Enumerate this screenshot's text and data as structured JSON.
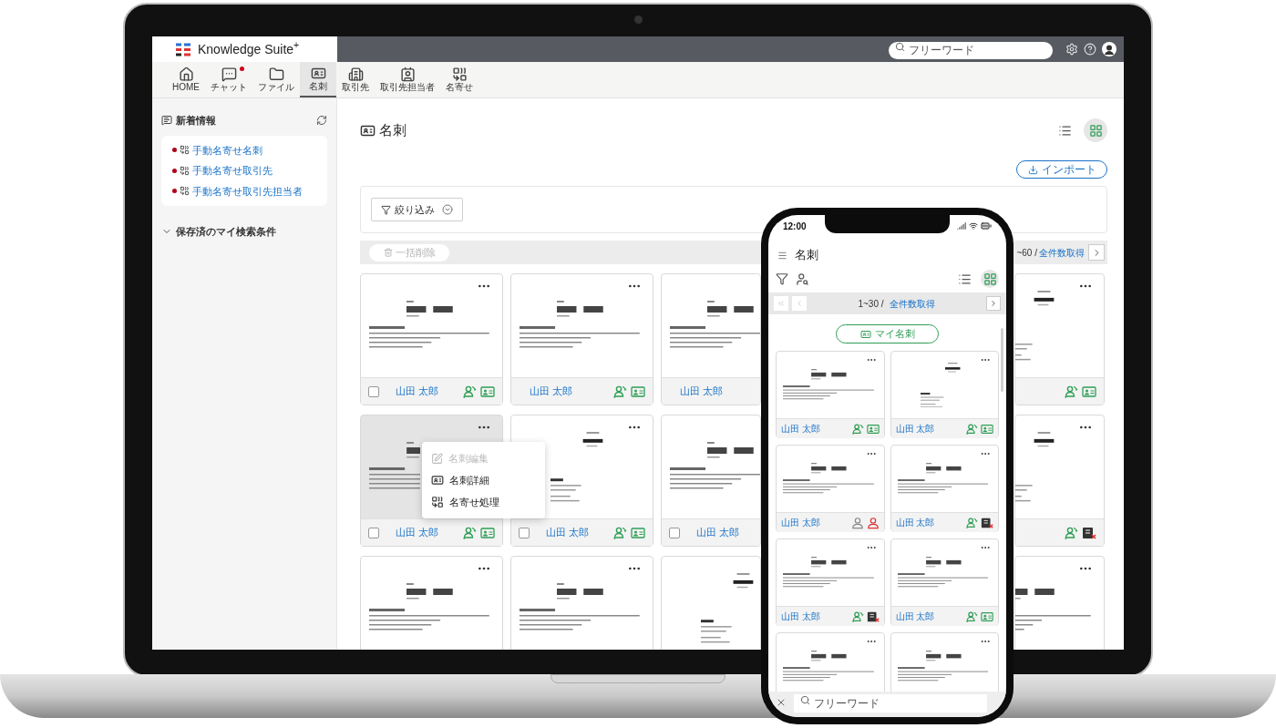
{
  "laptop": {
    "header": {
      "logo": "Knowledge Suite$^{+}$",
      "search": {
        "placeholder": "フリーワード"
      }
    },
    "nav": [
      {
        "label": "HOME",
        "selected": false,
        "badge": false
      },
      {
        "label": "チャット",
        "selected": false,
        "badge": true
      },
      {
        "label": "ファイル",
        "selected": false,
        "badge": false
      },
      {
        "label": "名刺",
        "selected": true,
        "badge": false
      },
      {
        "label": "取引先",
        "selected": false,
        "badge": false
      },
      {
        "label": "取引先担当者",
        "selected": false,
        "badge": false
      },
      {
        "label": "名寄せ",
        "selected": false,
        "badge": false
      }
    ],
    "sidebar": {
      "news_title": "新着情報",
      "news_items": [
        "手動名寄せ名刺",
        "手動名寄せ取引先",
        "手動名寄せ取引先担当者"
      ],
      "saved_searches": "保存済のマイ検索条件"
    },
    "main": {
      "title": "名刺",
      "views": [
        {
          "kind": "list",
          "selected": false
        },
        {
          "kind": "grid",
          "selected": true
        }
      ],
      "import_button": "インポート",
      "filter_button": "絞り込み",
      "bulk_delete": {
        "label": "一括削除",
        "disabled": true
      },
      "paging": {
        "range": "~60 /",
        "link": "全件数取得"
      },
      "card_rows": [
        {
          "cards": [
            {
              "highlighted": false,
              "checked": false,
              "name": "山田 太郎",
              "menu_button": true,
              "icons": [
                {
                  "kind": "sync"
                },
                {
                  "kind": "card"
                }
              ]
            },
            {
              "highlighted": false,
              "name": "山田 太郎",
              "menu_button": true,
              "icons": [
                {
                  "kind": "sync"
                },
                {
                  "kind": "card"
                }
              ]
            },
            {
              "highlighted": false,
              "name": "山田 太郎"
            },
            {
              "highlighted": false,
              "menu_button": true,
              "icons": [
                {
                  "kind": "sync"
                },
                {
                  "kind": "card"
                }
              ]
            }
          ]
        },
        {
          "cards": [
            {
              "highlighted": true,
              "checked": false,
              "name": "山田 太郎",
              "menu_button": true,
              "icons": [
                {
                  "kind": "sync"
                },
                {
                  "kind": "card"
                }
              ],
              "menu": [
                {
                  "label": "名刺編集",
                  "kind": "edit",
                  "disabled": true
                },
                {
                  "label": "名刺詳細",
                  "kind": "detail",
                  "disabled": false
                },
                {
                  "label": "名寄せ処理",
                  "kind": "merge",
                  "disabled": false
                }
              ]
            },
            {
              "highlighted": false,
              "checked": false,
              "name": "山田 太郎",
              "menu_button": true,
              "icons": [
                {
                  "kind": "sync"
                },
                {
                  "kind": "card"
                }
              ]
            },
            {
              "highlighted": false,
              "checked": false,
              "name": "山田 太郎"
            },
            {
              "highlighted": false,
              "menu_button": true,
              "icons": [
                {
                  "kind": "sync"
                },
                {
                  "kind": "card_x"
                }
              ]
            }
          ]
        },
        {
          "cards": [
            {
              "highlighted": false,
              "menu_button": true
            },
            {
              "highlighted": false,
              "menu_button": true
            },
            {
              "highlighted": false
            },
            {
              "highlighted": false,
              "menu_button": true
            }
          ]
        }
      ]
    }
  },
  "phone": {
    "time": "12:00",
    "title": "名刺",
    "views": [
      {
        "kind": "list",
        "selected": false
      },
      {
        "kind": "grid",
        "selected": true
      }
    ],
    "paging": {
      "range": "1~30 /",
      "link": "全件数取得",
      "back_disabled": true
    },
    "my_cards_button": "マイ名刺",
    "cards": [
      {
        "menu_button": true,
        "name": "山田 太郎",
        "icons": [
          {
            "kind": "sync"
          },
          {
            "kind": "card"
          }
        ]
      },
      {
        "menu_button": true,
        "name": "山田 太郎",
        "icons": [
          {
            "kind": "sync"
          },
          {
            "kind": "card"
          }
        ]
      },
      {
        "menu_button": true,
        "name": "山田 太郎",
        "icons": [
          {
            "kind": "person_gray"
          },
          {
            "kind": "person_red"
          }
        ]
      },
      {
        "menu_button": true,
        "name": "山田 太郎",
        "icons": [
          {
            "kind": "sync"
          },
          {
            "kind": "card_x"
          }
        ]
      },
      {
        "menu_button": true,
        "name": "山田 太郎",
        "icons": [
          {
            "kind": "sync"
          },
          {
            "kind": "card_x"
          }
        ]
      },
      {
        "menu_button": true,
        "name": "山田 太郎",
        "icons": [
          {
            "kind": "sync"
          },
          {
            "kind": "card"
          }
        ]
      },
      {
        "menu_button": true
      },
      {
        "menu_button": true
      }
    ],
    "search": {
      "placeholder": "フリーワード"
    }
  }
}
